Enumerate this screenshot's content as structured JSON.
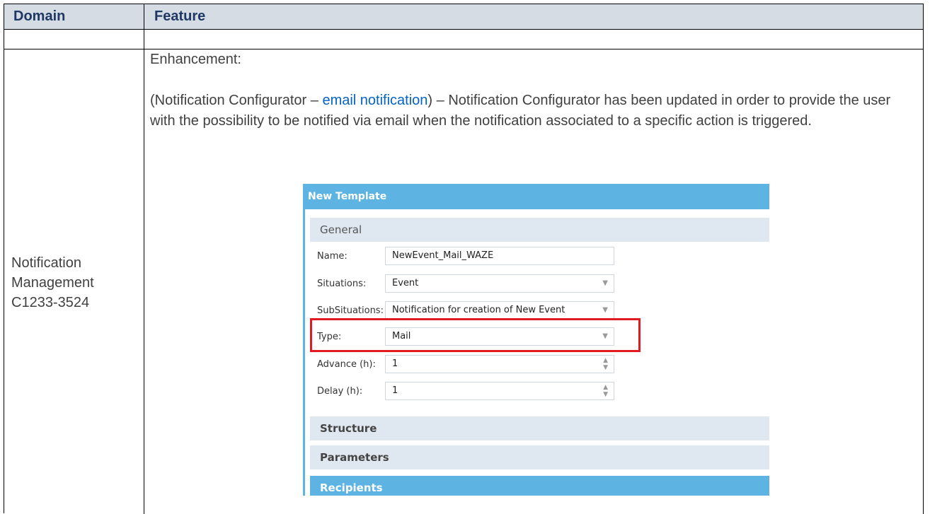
{
  "header": {
    "domain_col": "Domain",
    "feature_col": "Feature"
  },
  "row": {
    "domain": [
      "Notification",
      "Management",
      "C1233-3524"
    ],
    "feature_heading": "Enhancement:",
    "feature_prefix": "(Notification Configurator – ",
    "feature_link": "email notification",
    "feature_suffix": ") – Notification Configurator has been updated in order to provide the user with the possibility to be notified via email when the notification associated to a specific action is triggered."
  },
  "screenshot": {
    "title": "New Template",
    "section_general": "General",
    "fields": [
      {
        "label": "Name:",
        "value": "NewEvent_Mail_WAZE",
        "control": "text"
      },
      {
        "label": "Situations:",
        "value": "Event",
        "control": "select"
      },
      {
        "label": "SubSituations:",
        "value": "Notification for creation of New Event",
        "control": "select"
      },
      {
        "label": "Type:",
        "value": "Mail",
        "control": "select"
      },
      {
        "label": "Advance (h):",
        "value": "1",
        "control": "spinner"
      },
      {
        "label": "Delay (h):",
        "value": "1",
        "control": "spinner"
      }
    ],
    "section_structure": "Structure",
    "section_parameters": "Parameters",
    "section_recipients": "Recipients",
    "accent_color": "#5db4e3",
    "highlight_color": "#e21b23"
  }
}
